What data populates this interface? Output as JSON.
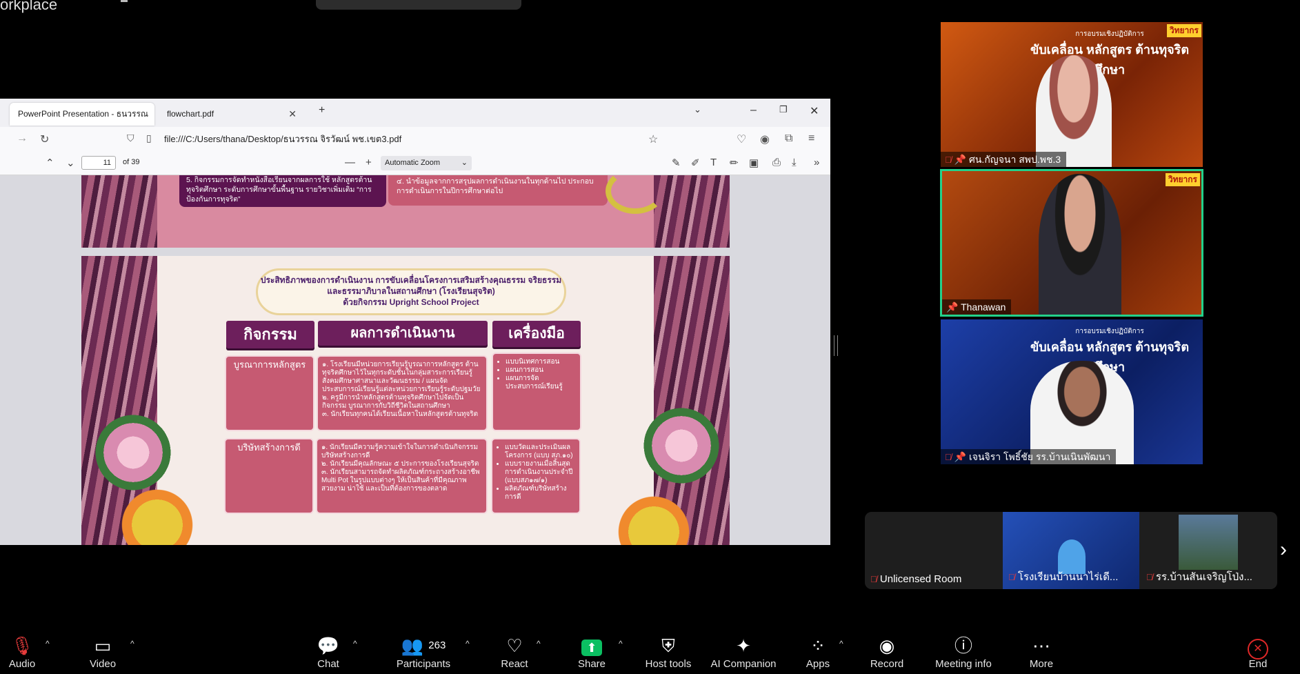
{
  "app": {
    "window_title": "orkplace"
  },
  "browser": {
    "tabs": [
      {
        "label": "PowerPoint Presentation - ธนวรรณ จ"
      },
      {
        "label": "flowchart.pdf"
      }
    ],
    "new_tab": "+",
    "url": "file:///C:/Users/thana/Desktop/ธนวรรณ จิรวัฒน์ พช.เขต3.pdf",
    "pdf": {
      "page_number": "11",
      "page_count": "of 39",
      "zoom": "Automatic Zoom"
    }
  },
  "slide": {
    "top_items": [
      {
        "num": "5.",
        "text": "กิจกรรมการจัดทำหนังสือเรียนจากผลการใช้ หลักสูตรต้านทุจริตศึกษา ระดับการศึกษาขั้นพื้นฐาน รายวิชาเพิ่มเติม “การป้องกันการทุจริต”"
      },
      {
        "num": "๔.",
        "text": "นำข้อมูลจากการสรุปผลการดำเนินงานในทุกด้านไป ประกอบการดำเนินการในปีการศึกษาต่อไป"
      }
    ],
    "title_lines": [
      "ประสิทธิภาพของการดำเนินงาน การขับเคลื่อนโครงการเสริมสร้างคุณธรรม จริยธรรม",
      "และธรรมาภิบาลในสถานศึกษา (โรงเรียนสุจริต)",
      "ด้วยกิจกรรม Upright School Project"
    ],
    "headers": [
      "กิจกรรม",
      "ผลการดำเนินงาน",
      "เครื่องมือ"
    ],
    "rows": [
      {
        "activity": "บูรณาการหลักสูตร",
        "results": [
          "๑. โรงเรียนมีหน่วยการเรียนรู้บูรณาการหลักสูตร ต้านทุจริตศึกษาไว้ในทุกระดับชั้นในกลุ่มสาระการเรียนรู้ สังคมศึกษาศาสนาและวัฒนธรรม / แผนจัด ประสบการณ์เรียนรู้แต่ละหน่วยการเรียนรู้ระดับปฐมวัย",
          "๒. ครูมีการนำหลักสูตรต้านทุจริตศึกษาไปจัดเป็นกิจกรรม บูรณาการกับวิถีชีวิตในสถานศึกษา",
          "๓. นักเรียนทุกคนได้เรียนเนื้อหาในหลักสูตรต้านทุจริต"
        ],
        "tools": [
          "แบบนิเทศการสอน",
          "แผนการสอน",
          "แผนการจัดประสบการณ์เรียนรู้"
        ]
      },
      {
        "activity": "บริษัทสร้างการดี",
        "results": [
          "๑. นักเรียนมีความรู้ความเข้าใจในการดำเนินกิจกรรม บริษัทสร้างการดี",
          "๒. นักเรียนมีคุณลักษณะ ๕ ประการของโรงเรียนสุจริต",
          "๓. นักเรียนสามารถจัดทำผลิตภัณฑ์กระถางสร้างอาชีพ Multi Pot ในรูปแบบต่างๆ ให้เป็นสินค้าที่มีคุณภาพ สวยงาม น่าใช้ และเป็นที่ต้องการของตลาด"
        ],
        "tools": [
          "แบบวัดและประเมินผลโครงการ (แบบ สภ.๑๐)",
          "แบบรายงานเมื่อสิ้นสุดการดำเนินงานประจำปี (แบบสภ๑๗/๑)",
          "ผลิตภัณฑ์บริษัทสร้างการดี"
        ]
      }
    ]
  },
  "video_tiles": [
    {
      "name": "ศน.กัญจนา สพป.พช.3",
      "badge": "วิทยากร",
      "banner_small": "การอบรมเชิงปฏิบัติการ",
      "banner_big": "ขับเคลื่อน หลักสูตร ต้านทุจริตศึกษา"
    },
    {
      "name": "Thanawan",
      "badge": "วิทยากร"
    },
    {
      "name": "เจนจิรา โพธิ์ชัย รร.บ้านเนินพัฒนา",
      "banner_small": "การอบรมเชิงปฏิบัติการ",
      "banner_big": "ขับเคลื่อน หลักสูตร ต้านทุจริตศึกษา"
    }
  ],
  "strip_tiles": [
    {
      "name": "Unlicensed Room"
    },
    {
      "name": "โรงเรียนบ้านนาไร่เดี..."
    },
    {
      "name": "รร.บ้านสันเจริญโป่ง..."
    }
  ],
  "toolbar": {
    "audio": "Audio",
    "video": "Video",
    "chat": "Chat",
    "participants": "Participants",
    "participants_count": "263",
    "react": "React",
    "share": "Share",
    "host_tools": "Host tools",
    "ai_companion": "AI Companion",
    "apps": "Apps",
    "record": "Record",
    "meeting_info": "Meeting info",
    "more": "More",
    "end": "End"
  },
  "colors": {
    "accent_green": "#23d18b",
    "share_green": "#0bbf62",
    "end_red": "#e02828",
    "slide_plum": "#6d1f5c",
    "slide_pink": "#c65a72"
  }
}
